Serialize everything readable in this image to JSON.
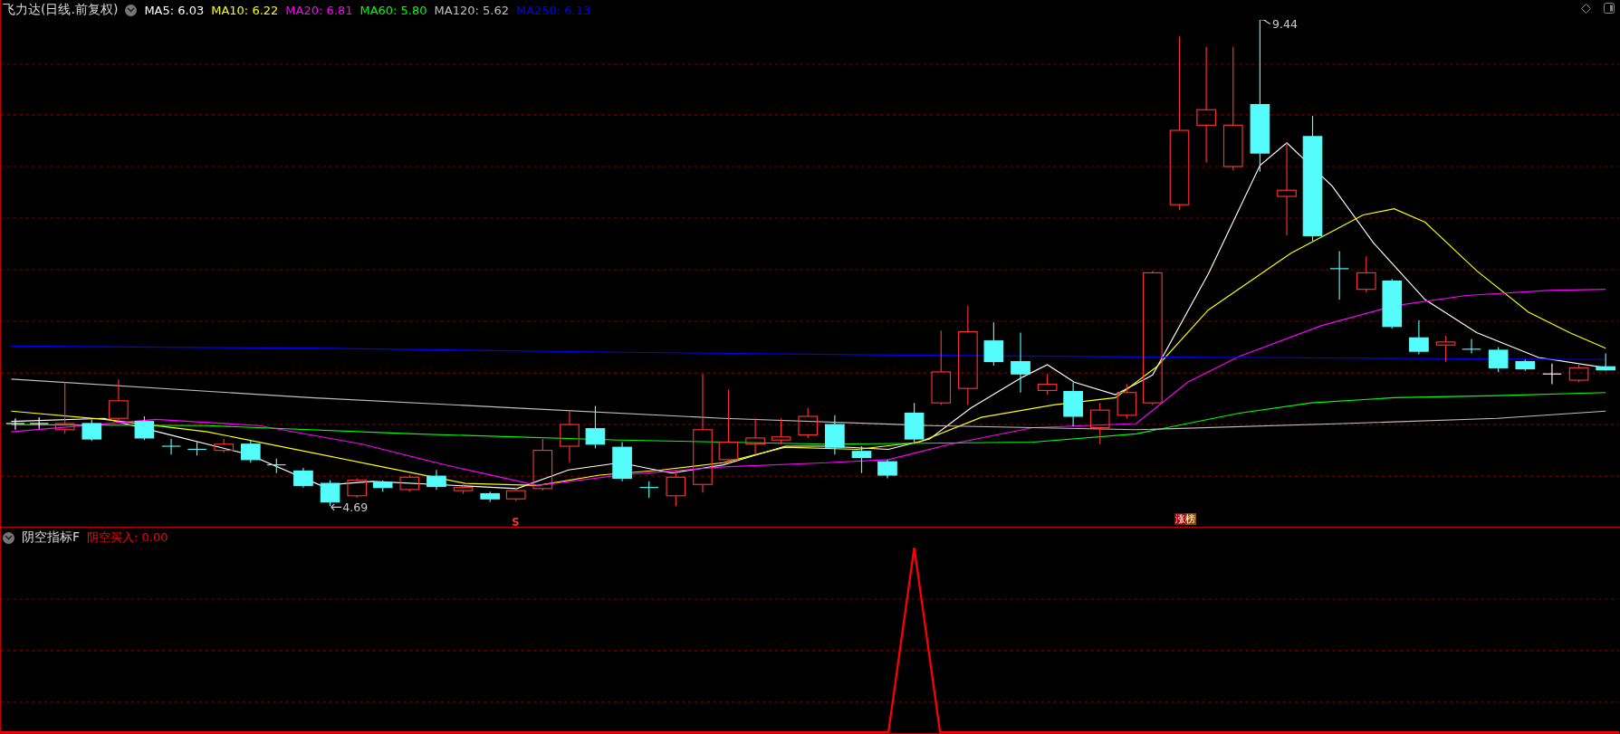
{
  "main_panel": {
    "title": "飞力达(日线.前复权)",
    "indicators": [
      {
        "text": "MA5: 6.03",
        "color": "#ffffff"
      },
      {
        "text": "MA10: 6.22",
        "color": "#ffff00"
      },
      {
        "text": "MA20: 6.81",
        "color": "#ff00ff"
      },
      {
        "text": "MA60: 5.80",
        "color": "#00ff00"
      },
      {
        "text": "MA120: 5.62",
        "color": "#c0c0c0"
      },
      {
        "text": "MA250: 6.13",
        "color": "#0000ff"
      }
    ],
    "high_label": "9.44",
    "low_label": "4.69",
    "signal_marker": "S",
    "badge": "涨榜"
  },
  "sub_panel": {
    "title": "阴空指标F",
    "indicators": [
      {
        "text": "阴空买入: 0.00",
        "color": "#ff0000"
      }
    ]
  }
}
